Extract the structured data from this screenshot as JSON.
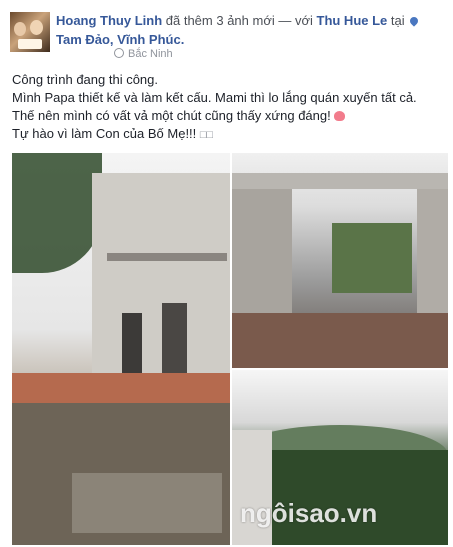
{
  "author": {
    "name": "Hoang Thuy Linh"
  },
  "header": {
    "action": " đã thêm 3 ảnh mới — với ",
    "tagged": "Thu Hue Le",
    "at": " tại",
    "location": "Tam Đảo, Vĩnh Phúc."
  },
  "meta": {
    "place": "Bắc Ninh"
  },
  "body": {
    "line1": "Công trình đang thi công.",
    "line2": "Mình Papa thiết kế và làm kết cấu. Mami thì lo lắng quán xuyến tất cả. Thế nên mình có vất vả một chút cũng thấy xứng đáng!",
    "line3": "Tự hào vì làm Con của Bố Mẹ!!!",
    "trailing_boxes": "□□"
  },
  "watermark": {
    "text": "ngôisao.vn"
  },
  "icons": {
    "location": "location-pin-icon",
    "globe": "globe-icon",
    "heart": "heart-emoji"
  }
}
